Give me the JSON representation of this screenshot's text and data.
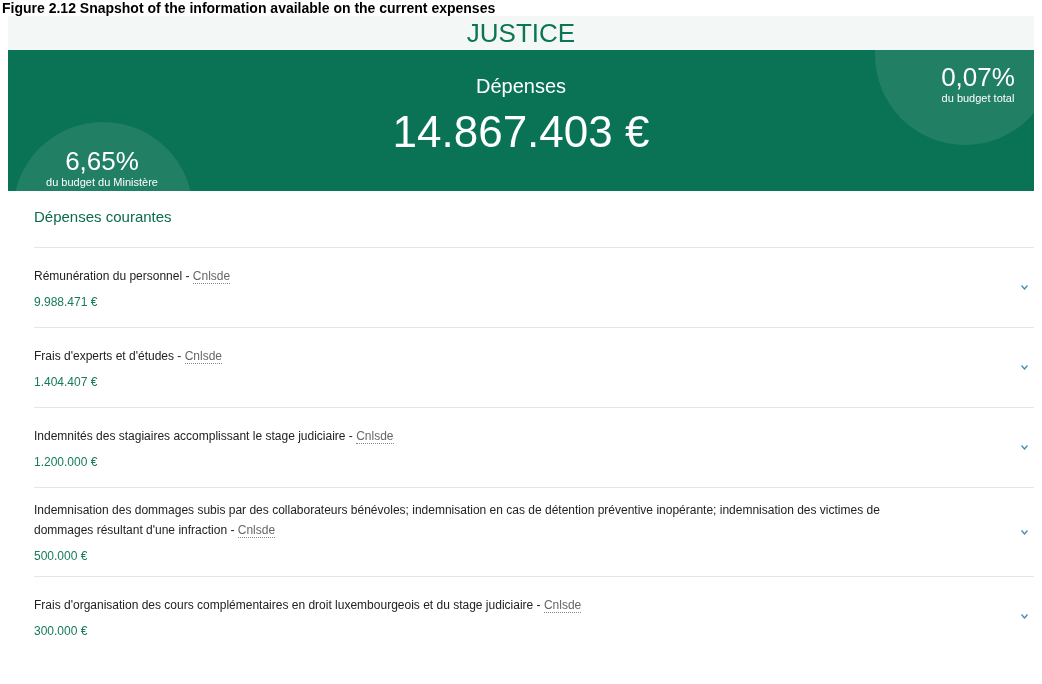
{
  "caption": "Figure 2.12 Snapshot of the information available on the current expenses",
  "ministry": "JUSTICE",
  "summary": {
    "title": "Dépenses",
    "total": "14.867.403 €",
    "left": {
      "value": "6,65%",
      "label": "du budget du Ministère"
    },
    "right": {
      "value": "0,07%",
      "label": "du budget total"
    }
  },
  "section_title": "Dépenses courantes",
  "items": [
    {
      "title": "Rémunération du personnel",
      "separator": "-",
      "source": "Cnlsde",
      "amount": "9.988.471 €",
      "expanded": false
    },
    {
      "title": "Frais d'experts et d'études",
      "separator": "-",
      "source": "Cnlsde",
      "amount": "1.404.407 €",
      "expanded": false
    },
    {
      "title": "Indemnités des stagiaires accomplissant le stage judiciaire",
      "separator": "-",
      "source": "Cnlsde",
      "amount": "1.200.000 €",
      "expanded": false
    },
    {
      "title": "Indemnisation des dommages subis par des collaborateurs bénévoles; indemnisation en cas de détention préventive inopérante; indemnisation des victimes de dommages résultant d'une infraction",
      "separator": "-",
      "source": "Cnlsde",
      "amount": "500.000 €",
      "expanded": false
    },
    {
      "title": "Frais d'organisation des cours complémentaires en droit luxembourgeois et du stage judiciaire",
      "separator": "-",
      "source": "Cnlsde",
      "amount": "300.000 €",
      "expanded": false
    }
  ]
}
